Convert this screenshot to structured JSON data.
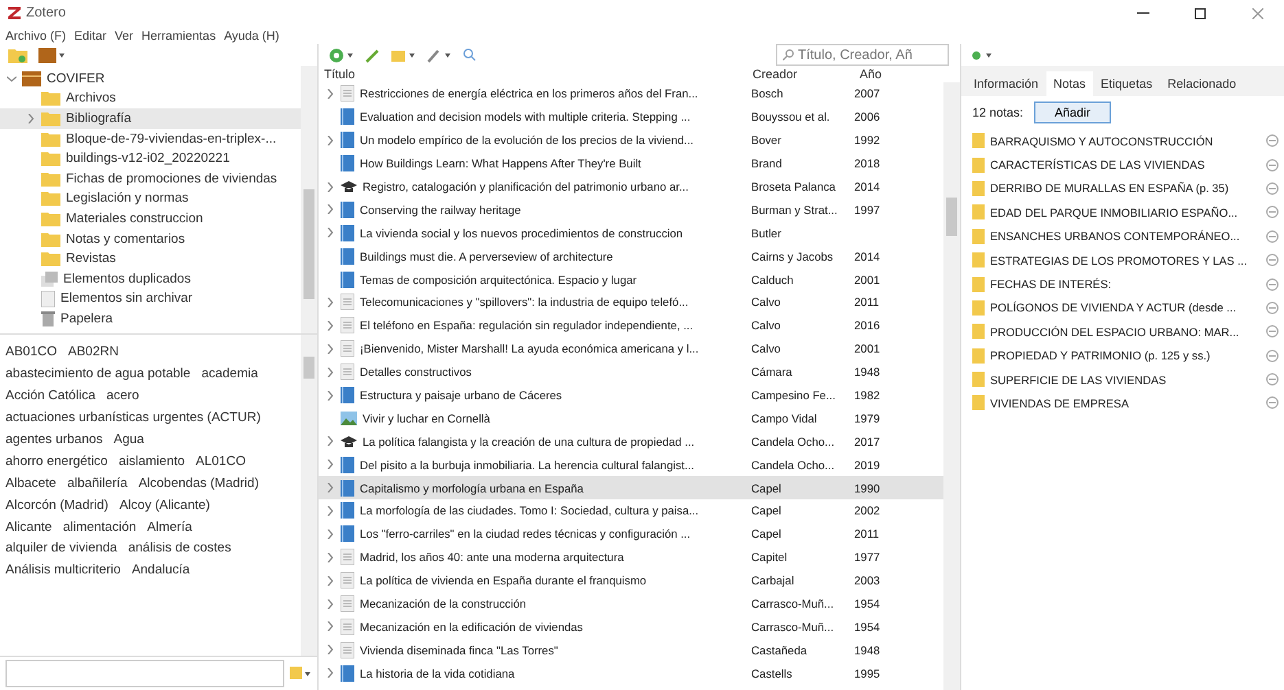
{
  "window": {
    "title": "Zotero"
  },
  "menu": [
    "Archivo (F)",
    "Editar",
    "Ver",
    "Herramientas",
    "Ayuda (H)"
  ],
  "collections": [
    {
      "name": "COVIFER",
      "kind": "library",
      "expanded": true,
      "selected": false,
      "children": [
        {
          "name": "Archivos",
          "kind": "folder",
          "selected": false
        },
        {
          "name": "Bibliografía",
          "kind": "folder",
          "selected": true,
          "has_children": true
        },
        {
          "name": "Bloque-de-79-viviendas-en-triplex-...",
          "kind": "folder",
          "selected": false
        },
        {
          "name": "buildings-v12-i02_20220221",
          "kind": "folder",
          "selected": false
        },
        {
          "name": "Fichas de promociones de viviendas",
          "kind": "folder",
          "selected": false
        },
        {
          "name": "Legislación y normas",
          "kind": "folder",
          "selected": false
        },
        {
          "name": "Materiales construccion",
          "kind": "folder",
          "selected": false
        },
        {
          "name": "Notas y comentarios",
          "kind": "folder",
          "selected": false
        },
        {
          "name": "Revistas",
          "kind": "folder",
          "selected": false
        },
        {
          "name": "Elementos duplicados",
          "kind": "duplicates",
          "selected": false
        },
        {
          "name": "Elementos sin archivar",
          "kind": "unfiled",
          "selected": false
        },
        {
          "name": "Papelera",
          "kind": "trash",
          "selected": false
        }
      ]
    }
  ],
  "tags": [
    [
      "AB01CO",
      "AB02RN"
    ],
    [
      "abastecimiento de agua potable",
      "academia"
    ],
    [
      "Acción Católica",
      "acero"
    ],
    [
      "actuaciones urbanísticas urgentes (ACTUR)"
    ],
    [
      "agentes urbanos",
      "Agua"
    ],
    [
      "ahorro energético",
      "aislamiento",
      "AL01CO"
    ],
    [
      "Albacete",
      "albañilería",
      "Alcobendas (Madrid)"
    ],
    [
      "Alcorcón (Madrid)",
      "Alcoy (Alicante)"
    ],
    [
      "Alicante",
      "alimentación",
      "Almería"
    ],
    [
      "alquiler de vivienda",
      "análisis de costes"
    ],
    [
      "Análisis multicriterio",
      "Andalucía"
    ]
  ],
  "search": {
    "placeholder": "Título, Creador, Añ"
  },
  "columns": [
    "Título",
    "Creador",
    "Año"
  ],
  "items": [
    {
      "title": "Restricciones de energía eléctrica en los primeros años del Fran...",
      "creator": "Bosch",
      "year": "2007",
      "kind": "doc",
      "has_children": true,
      "selected": false
    },
    {
      "title": "Evaluation and decision models with multiple criteria. Stepping ...",
      "creator": "Bouyssou et al.",
      "year": "2006",
      "kind": "book",
      "has_children": false,
      "selected": false
    },
    {
      "title": "Un modelo empírico de la evolución de los precios de la viviend...",
      "creator": "Bover",
      "year": "1992",
      "kind": "book",
      "has_children": true,
      "selected": false
    },
    {
      "title": "How Buildings Learn: What Happens After They're Built",
      "creator": "Brand",
      "year": "2018",
      "kind": "book",
      "has_children": false,
      "selected": false
    },
    {
      "title": "Registro, catalogación y planificación del patrimonio urbano ar...",
      "creator": "Broseta Palanca",
      "year": "2014",
      "kind": "thesis",
      "has_children": true,
      "selected": false
    },
    {
      "title": "Conserving the railway heritage",
      "creator": "Burman y Strat...",
      "year": "1997",
      "kind": "book",
      "has_children": true,
      "selected": false
    },
    {
      "title": "La vivienda social y los nuevos procedimientos de construccion",
      "creator": "Butler",
      "kind": "book",
      "has_children": true,
      "selected": false
    },
    {
      "title": "Buildings must die. A perverseview of architecture",
      "creator": "Cairns y Jacobs",
      "year": "2014",
      "kind": "book",
      "has_children": false,
      "selected": false
    },
    {
      "title": "Temas de composición arquitectónica. Espacio y lugar",
      "creator": "Calduch",
      "year": "2001",
      "kind": "book",
      "has_children": false,
      "selected": false
    },
    {
      "title": "Telecomunicaciones y \"spillovers\": la industria de equipo telefó...",
      "creator": "Calvo",
      "year": "2011",
      "kind": "doc",
      "has_children": true,
      "selected": false
    },
    {
      "title": "El teléfono en España: regulación sin regulador independiente, ...",
      "creator": "Calvo",
      "year": "2016",
      "kind": "doc",
      "has_children": true,
      "selected": false
    },
    {
      "title": "¡Bienvenido, Mister Marshall! La ayuda económica americana y l...",
      "creator": "Calvo",
      "year": "2001",
      "kind": "doc",
      "has_children": true,
      "selected": false
    },
    {
      "title": "Detalles constructivos",
      "creator": "Cámara",
      "year": "1948",
      "kind": "doc",
      "has_children": true,
      "selected": false
    },
    {
      "title": "Estructura y paisaje urbano de Cáceres",
      "creator": "Campesino Fe...",
      "year": "1982",
      "kind": "book",
      "has_children": true,
      "selected": false
    },
    {
      "title": "Vivir y luchar en Cornellà",
      "creator": "Campo Vidal",
      "year": "1979",
      "kind": "image",
      "has_children": false,
      "selected": false
    },
    {
      "title": "La política falangista y la creación de una cultura de propiedad ...",
      "creator": "Candela Ocho...",
      "year": "2017",
      "kind": "thesis",
      "has_children": true,
      "selected": false
    },
    {
      "title": "Del pisito a la burbuja inmobiliaria. La herencia cultural falangist...",
      "creator": "Candela Ocho...",
      "year": "2019",
      "kind": "book",
      "has_children": true,
      "selected": false
    },
    {
      "title": "Capitalismo y morfología urbana en España",
      "creator": "Capel",
      "year": "1990",
      "kind": "book",
      "has_children": true,
      "selected": true
    },
    {
      "title": "La morfología de las ciudades. Tomo I: Sociedad, cultura y paisa...",
      "creator": "Capel",
      "year": "2002",
      "kind": "book",
      "has_children": true,
      "selected": false
    },
    {
      "title": "Los \"ferro-carriles\" en la ciudad redes técnicas y configuración ...",
      "creator": "Capel",
      "year": "2011",
      "kind": "book",
      "has_children": true,
      "selected": false
    },
    {
      "title": "Madrid, los años 40: ante una moderna arquitectura",
      "creator": "Capitel",
      "year": "1977",
      "kind": "doc",
      "has_children": true,
      "selected": false
    },
    {
      "title": "La política de vivienda en España durante el franquismo",
      "creator": "Carbajal",
      "year": "2003",
      "kind": "doc",
      "has_children": true,
      "selected": false
    },
    {
      "title": "Mecanización de la construcción",
      "creator": "Carrasco-Muñ...",
      "year": "1954",
      "kind": "doc",
      "has_children": true,
      "selected": false
    },
    {
      "title": "Mecanización en la edificación de viviendas",
      "creator": "Carrasco-Muñ...",
      "year": "1954",
      "kind": "doc",
      "has_children": true,
      "selected": false
    },
    {
      "title": "Vivienda diseminada finca \"Las Torres\"",
      "creator": "Castañeda",
      "year": "1948",
      "kind": "doc",
      "has_children": true,
      "selected": false
    },
    {
      "title": "La historia de la vida cotidiana",
      "creator": "Castells",
      "year": "1995",
      "kind": "book",
      "has_children": true,
      "selected": false
    }
  ],
  "pane_tabs": [
    {
      "label": "Información",
      "selected": false
    },
    {
      "label": "Notas",
      "selected": true
    },
    {
      "label": "Etiquetas",
      "selected": false
    },
    {
      "label": "Relacionado",
      "selected": false
    }
  ],
  "notes_count": "12 notas:",
  "add_button": "Añadir",
  "notes": [
    "BARRAQUISMO Y AUTOCONSTRUCCIÓN",
    "CARACTERÍSTICAS DE LAS VIVIENDAS",
    "DERRIBO DE MURALLAS EN ESPAÑA (p. 35)",
    "EDAD DEL PARQUE INMOBILIARIO ESPAÑO...",
    "ENSANCHES URBANOS CONTEMPORÁNEO...",
    "ESTRATEGIAS DE LOS PROMOTORES Y LAS ...",
    "FECHAS DE INTERÉS:",
    "POLÍGONOS DE VIVIENDA Y ACTUR (desde ...",
    "PRODUCCIÓN DEL ESPACIO URBANO: MAR...",
    "PROPIEDAD Y PATRIMONIO (p. 125 y ss.)",
    "SUPERFICIE DE LAS VIVIENDAS",
    "VIVIENDAS DE EMPRESA"
  ]
}
